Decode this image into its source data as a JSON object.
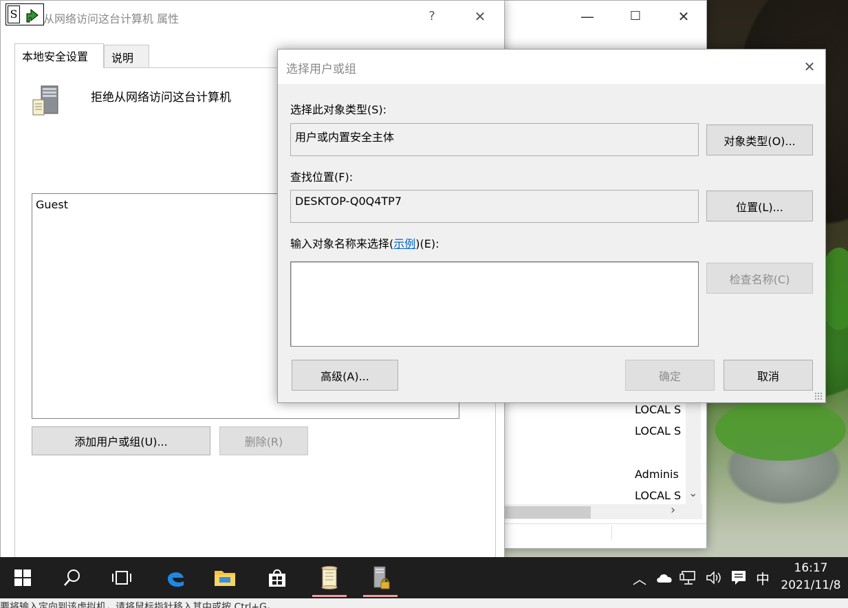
{
  "back_window": {
    "minimize": "—",
    "maximize": "☐",
    "close": "✕",
    "rows": [
      "LOCAL S",
      "LOCAL S",
      "Adminis",
      "LOCAL S"
    ],
    "vscroll_down": "⌄",
    "hscroll_right": "›"
  },
  "props_window": {
    "title": "从网络访问这台计算机 属性",
    "help": "?",
    "close": "✕",
    "tabs": [
      "本地安全设置",
      "说明"
    ],
    "policy_title": "拒绝从网络访问这台计算机",
    "users": [
      "Guest"
    ],
    "add_button": "添加用户或组(U)...",
    "remove_button": "删除(R)"
  },
  "select_dialog": {
    "title": "选择用户或组",
    "close": "✕",
    "object_type_label": "选择此对象类型(S):",
    "object_type_value": "用户或内置安全主体",
    "object_type_button": "对象类型(O)...",
    "location_label": "查找位置(F):",
    "location_value": "DESKTOP-Q0Q4TP7",
    "location_button": "位置(L)...",
    "enter_names_prefix": "输入对象名称来选择(",
    "enter_names_link": "示例",
    "enter_names_suffix": ")(E):",
    "check_names_button": "检查名称(C)",
    "advanced_button": "高级(A)...",
    "ok_button": "确定",
    "cancel_button": "取消"
  },
  "app_icons": {
    "s_label": "S"
  },
  "taskbar": {
    "tray_chevron": "︿",
    "ime": "中",
    "time": "16:17",
    "date": "2021/11/8"
  },
  "bottom_strip": {
    "text": "要将输入定向到该虚拟机，请将鼠标指针移入其中或按 Ctrl+G。"
  },
  "colors": {
    "accent": "#0078d7",
    "taskbar": "#1e1e1e",
    "dialog_bg": "#f0f0f0"
  }
}
